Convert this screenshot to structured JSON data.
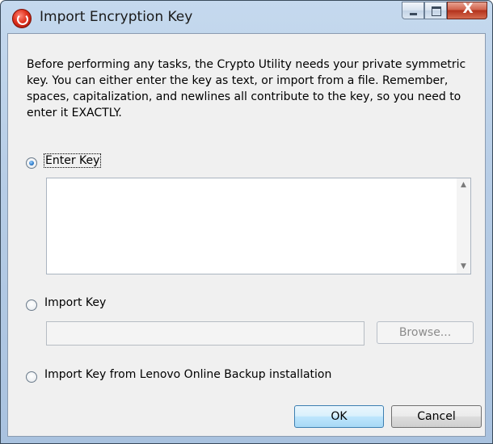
{
  "window": {
    "title": "Import Encryption Key",
    "close_glyph": "X"
  },
  "description": "Before performing any tasks, the Crypto Utility needs your private symmetric key.  You can either enter the key as text, or import from a file.  Remember, spaces, capitalization, and newlines all contribute to the key, so you need to enter it EXACTLY.",
  "options": {
    "enter_key": {
      "label": "Enter Key",
      "checked": true
    },
    "import_key": {
      "label": "Import Key",
      "checked": false
    },
    "import_lenovo": {
      "label": "Import Key from Lenovo Online Backup installation",
      "checked": false
    }
  },
  "key_text": {
    "value": ""
  },
  "import_path": {
    "value": ""
  },
  "buttons": {
    "browse": "Browse...",
    "ok": "OK",
    "cancel": "Cancel"
  },
  "icons": {
    "app": "crypto-utility-icon",
    "minimize": "minimize-icon",
    "maximize": "maximize-icon",
    "close": "close-icon",
    "scroll_up": "scroll-up-arrow-icon",
    "scroll_down": "scroll-down-arrow-icon"
  }
}
